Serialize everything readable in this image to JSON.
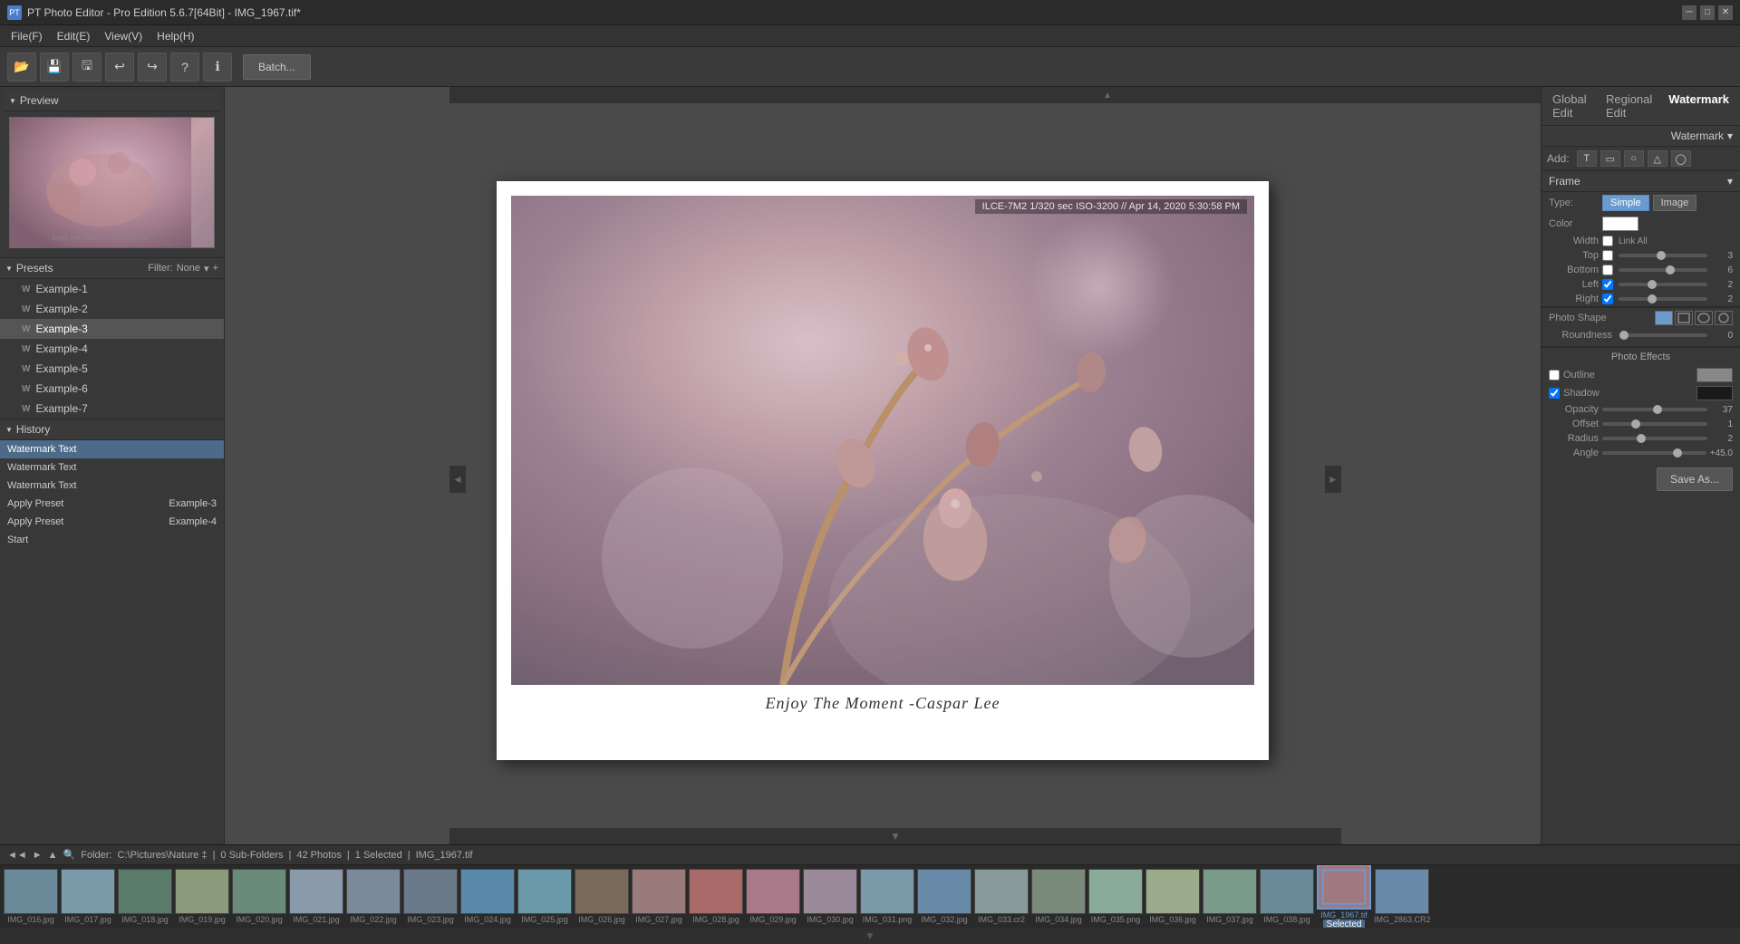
{
  "titleBar": {
    "title": "PT Photo Editor - Pro Edition 5.6.7[64Bit] - IMG_1967.tif*",
    "icon": "PT",
    "controls": [
      "minimize",
      "maximize",
      "close"
    ]
  },
  "menuBar": {
    "items": [
      "File(F)",
      "Edit(E)",
      "View(V)",
      "Help(H)"
    ]
  },
  "toolbar": {
    "buttons": [
      "open-folder",
      "save",
      "save-as",
      "undo",
      "redo",
      "help",
      "info"
    ],
    "batch_label": "Batch..."
  },
  "topTabs": {
    "items": [
      "Global Edit",
      "Regional Edit",
      "Watermark"
    ],
    "active": "Watermark"
  },
  "leftPanel": {
    "preview": {
      "header": "Preview",
      "caption": "Enjoy The Moment - Photographer"
    },
    "presets": {
      "header": "Presets",
      "filter_label": "Filter:",
      "filter_value": "None",
      "items": [
        {
          "label": "Example-1",
          "active": false
        },
        {
          "label": "Example-2",
          "active": false
        },
        {
          "label": "Example-3",
          "active": true
        },
        {
          "label": "Example-4",
          "active": false
        },
        {
          "label": "Example-5",
          "active": false
        },
        {
          "label": "Example-6",
          "active": false
        },
        {
          "label": "Example-7",
          "active": false
        }
      ]
    },
    "history": {
      "header": "History",
      "items": [
        {
          "label": "Watermark Text",
          "value": "",
          "active": true
        },
        {
          "label": "Watermark Text",
          "value": "",
          "active": false
        },
        {
          "label": "Watermark Text",
          "value": "",
          "active": false
        },
        {
          "label": "Apply Preset",
          "value": "Example-3",
          "active": false
        },
        {
          "label": "Apply Preset",
          "value": "Example-4",
          "active": false
        },
        {
          "label": "Start",
          "value": "",
          "active": false
        }
      ]
    }
  },
  "canvas": {
    "exif": "ILCE-7M2 1/320 sec ISO-3200 // Apr 14, 2020 5:30:58 PM",
    "watermark": "Enjoy The Moment -Caspar Lee"
  },
  "rightPanel": {
    "tabs": [
      "Watermark"
    ],
    "active_tab": "Watermark",
    "watermark_dropdown": "Watermark",
    "add_label": "Add:",
    "add_icons": [
      "text",
      "rect",
      "circle",
      "triangle",
      "ellipse"
    ],
    "frame": {
      "header": "Frame",
      "type": {
        "label": "Type:",
        "options": [
          "Simple",
          "Image"
        ],
        "active": "Simple"
      },
      "color": {
        "label": "Color",
        "value": "#ffffff"
      },
      "width": {
        "link_all_label": "Link All",
        "top": {
          "label": "Top",
          "checked": false,
          "value": 3.0,
          "percent": 45
        },
        "bottom": {
          "label": "Bottom",
          "checked": false,
          "value": 6.0,
          "percent": 55
        },
        "left": {
          "label": "Left",
          "checked": true,
          "value": 2.0,
          "percent": 35
        },
        "right": {
          "label": "Right",
          "checked": true,
          "value": 2.0,
          "percent": 35
        }
      }
    },
    "photoShape": {
      "header": "Photo Shape",
      "shapes": [
        "rect-filled",
        "rect",
        "circle",
        "ellipse"
      ],
      "roundness": {
        "label": "Roundness",
        "value": 0,
        "percent": 0
      }
    },
    "photoEffects": {
      "header": "Photo Effects",
      "outline": {
        "label": "Outline",
        "checked": false,
        "color": "#888888"
      },
      "shadow": {
        "label": "Shadow",
        "checked": true,
        "color": "#000000",
        "opacity": {
          "label": "Opacity",
          "value": 37,
          "percent": 50
        },
        "offset": {
          "label": "Offset",
          "value": 1.0,
          "percent": 30
        },
        "radius": {
          "label": "Radius",
          "value": 2.0,
          "percent": 35
        },
        "angle": {
          "label": "Angle",
          "value": "+45.0",
          "percent": 70
        }
      }
    },
    "save_as_label": "Save As..."
  },
  "folderBar": {
    "folder_label": "Folder:",
    "folder_path": "C:\\Pictures\\Nature ‡",
    "sub_folders": "0 Sub-Folders",
    "photos": "42 Photos",
    "selected": "1 Selected",
    "filename": "IMG_1967.tif"
  },
  "filmstrip": {
    "selected_label": "Selected",
    "items": [
      {
        "name": "IMG_016.jpg",
        "selected": false,
        "color": "#6a8a9a"
      },
      {
        "name": "IMG_017.jpg",
        "selected": false,
        "color": "#7a9aaa"
      },
      {
        "name": "IMG_018.jpg",
        "selected": false,
        "color": "#5a7a6a"
      },
      {
        "name": "IMG_019.jpg",
        "selected": false,
        "color": "#8a9a7a"
      },
      {
        "name": "IMG_020.jpg",
        "selected": false,
        "color": "#6a8a7a"
      },
      {
        "name": "IMG_021.jpg",
        "selected": false,
        "color": "#8a9aaa"
      },
      {
        "name": "IMG_022.jpg",
        "selected": false,
        "color": "#7a8a9a"
      },
      {
        "name": "IMG_023.jpg",
        "selected": false,
        "color": "#6a7a8a"
      },
      {
        "name": "IMG_024.jpg",
        "selected": false,
        "color": "#5a8aaa"
      },
      {
        "name": "IMG_025.jpg",
        "selected": false,
        "color": "#6a9aaa"
      },
      {
        "name": "IMG_026.jpg",
        "selected": false,
        "color": "#7a6a5a"
      },
      {
        "name": "IMG_027.jpg",
        "selected": false,
        "color": "#9a7a7a"
      },
      {
        "name": "IMG_028.jpg",
        "selected": false,
        "color": "#aa6a6a"
      },
      {
        "name": "IMG_029.jpg",
        "selected": false,
        "color": "#aa7a8a"
      },
      {
        "name": "IMG_030.jpg",
        "selected": false,
        "color": "#9a8a9a"
      },
      {
        "name": "IMG_031.png",
        "selected": false,
        "color": "#7a9aaa"
      },
      {
        "name": "IMG_032.jpg",
        "selected": false,
        "color": "#6a8aaa"
      },
      {
        "name": "IMG_033.cr2",
        "selected": false,
        "color": "#8a9a9a"
      },
      {
        "name": "IMG_034.jpg",
        "selected": false,
        "color": "#7a8a7a"
      },
      {
        "name": "IMG_035.png",
        "selected": false,
        "color": "#8aaa9a"
      },
      {
        "name": "IMG_036.jpg",
        "selected": false,
        "color": "#9aaa8a"
      },
      {
        "name": "IMG_037.jpg",
        "selected": false,
        "color": "#7a9a8a"
      },
      {
        "name": "IMG_038.jpg",
        "selected": false,
        "color": "#6a8a9a"
      },
      {
        "name": "IMG_1967.tif",
        "selected": true,
        "color": "#a07880"
      },
      {
        "name": "IMG_2863.CR2",
        "selected": false,
        "color": "#6a8aaa"
      }
    ]
  }
}
